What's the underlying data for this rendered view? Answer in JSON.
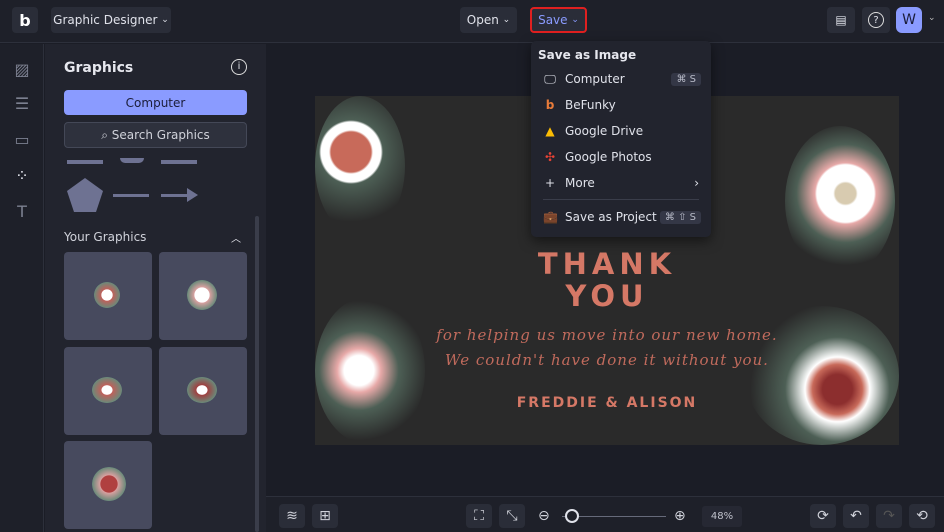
{
  "header": {
    "app_menu": "Graphic Designer",
    "open": "Open",
    "save": "Save",
    "avatar": "W"
  },
  "panel": {
    "title": "Graphics",
    "computer": "Computer",
    "search": "Search Graphics",
    "your_graphics": "Your Graphics"
  },
  "save_menu": {
    "heading": "Save as Image",
    "items": [
      {
        "label": "Computer",
        "shortcut": "⌘ S",
        "icon": "monitor-icon"
      },
      {
        "label": "BeFunky",
        "icon": "befunky-icon"
      },
      {
        "label": "Google Drive",
        "icon": "google-drive-icon"
      },
      {
        "label": "Google Photos",
        "icon": "google-photos-icon"
      },
      {
        "label": "More",
        "icon": "plus-icon"
      },
      {
        "label": "Save as Project",
        "shortcut": "⌘ ⇧ S",
        "icon": "briefcase-icon"
      }
    ]
  },
  "card": {
    "title1": "THANK",
    "title2": "YOU",
    "line1": "for helping us move into our new home.",
    "line2": "We couldn't have done it without you.",
    "names": "FREDDIE & ALISON"
  },
  "toolbar": {
    "zoom": "48%",
    "zoom_value": 48
  },
  "colors": {
    "accent": "#8a9bff",
    "save_highlight": "#e02020",
    "card_text": "#d57866"
  }
}
